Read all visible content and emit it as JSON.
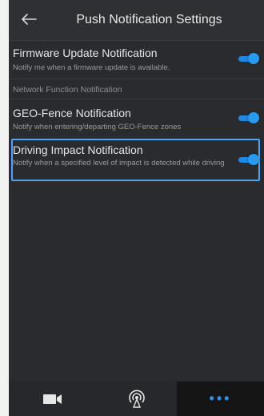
{
  "header": {
    "back_icon": "arrow-left-icon",
    "title": "Push Notification Settings"
  },
  "settings": [
    {
      "title": "Firmware Update Notification",
      "description": "Notify me when a firmware update is available.",
      "enabled": true
    },
    {
      "title": "GEO-Fence Notification",
      "description": "Notify when entering/departing GEO-Fence zones",
      "enabled": true
    },
    {
      "title": "Driving Impact Notification",
      "description": "Notify when a specified level of impact is detected while driving",
      "enabled": true
    }
  ],
  "section_label": "Network Function Notification",
  "bottom_nav": {
    "items": [
      "video-camera-icon",
      "wireless-signal-icon",
      "more-dots-icon"
    ],
    "more_glyph": "•••",
    "active_index": 2
  },
  "colors": {
    "background": "#2a2b2e",
    "accent": "#1e88e5",
    "highlight": "#4aa3f5"
  }
}
